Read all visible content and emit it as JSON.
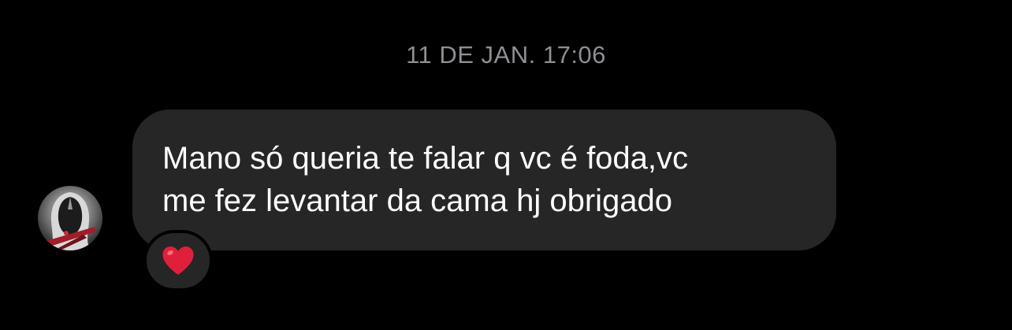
{
  "conversation": {
    "timestamp": "11 DE JAN. 17:06",
    "message": {
      "lines": [
        "Mano só queria te falar q vc é foda,vc",
        "me fez levantar da cama hj obrigado"
      ]
    },
    "reaction": {
      "icon": "red-heart-icon",
      "color": "#e0203a"
    }
  },
  "colors": {
    "background": "#000000",
    "bubble": "#262626",
    "timestamp_text": "#8e8e93",
    "message_text": "#ffffff"
  }
}
